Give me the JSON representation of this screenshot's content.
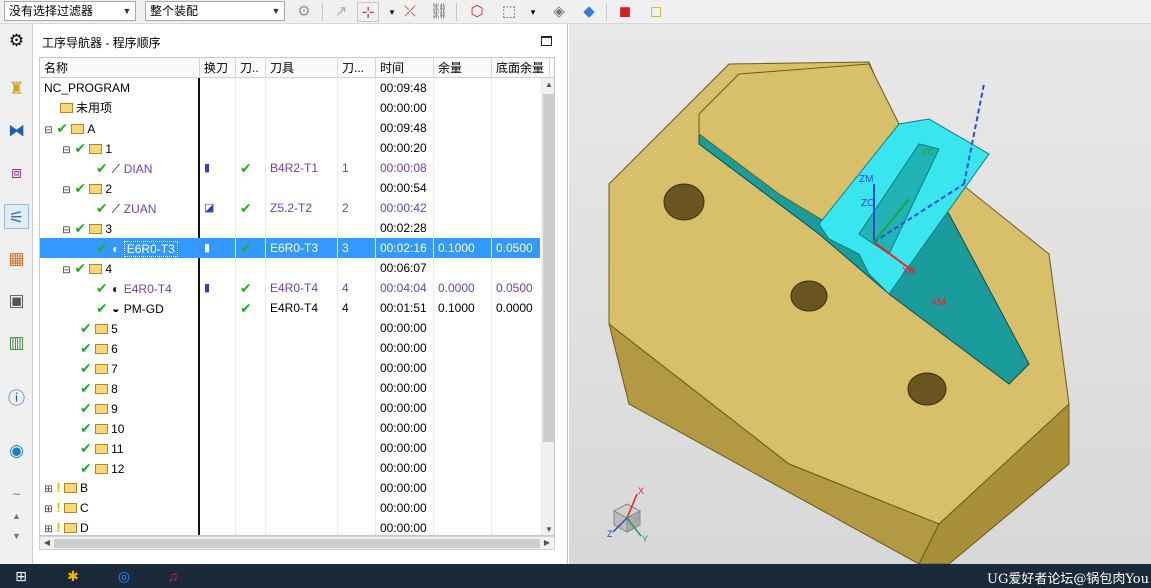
{
  "toolbar": {
    "filter_value": "没有选择过滤器",
    "scope_value": "整个装配"
  },
  "panel": {
    "title": "工序导航器 - 程序顺序"
  },
  "columns": [
    "名称",
    "换刀",
    "刀..",
    "刀具",
    "刀...",
    "时间",
    "余量",
    "底面余量"
  ],
  "rows": [
    {
      "name": "NC_PROGRAM",
      "time": "00:09:48"
    },
    {
      "name": "未用项",
      "time": "00:00:00"
    },
    {
      "name": "A",
      "time": "00:09:48"
    },
    {
      "name": "1",
      "time": "00:00:20"
    },
    {
      "name": "DIAN",
      "tool": "B4R2-T1",
      "tool_no": "1",
      "time": "00:00:08"
    },
    {
      "name": "2",
      "time": "00:00:54"
    },
    {
      "name": "ZUAN",
      "tool": "Z5.2-T2",
      "tool_no": "2",
      "time": "00:00:42"
    },
    {
      "name": "3",
      "time": "00:02:28"
    },
    {
      "name": "E6R0-T3",
      "tool": "E6R0-T3",
      "tool_no": "3",
      "time": "00:02:16",
      "stock": "0.1000",
      "floor": "0.0500"
    },
    {
      "name": "4",
      "time": "00:06:07"
    },
    {
      "name": "E4R0-T4",
      "tool": "E4R0-T4",
      "tool_no": "4",
      "time": "00:04:04",
      "stock": "0.0000",
      "floor": "0.0500"
    },
    {
      "name": "PM-GD",
      "tool": "E4R0-T4",
      "tool_no": "4",
      "time": "00:01:51",
      "stock": "0.1000",
      "floor": "0.0000"
    },
    {
      "name": "5",
      "time": "00:00:00"
    },
    {
      "name": "6",
      "time": "00:00:00"
    },
    {
      "name": "7",
      "time": "00:00:00"
    },
    {
      "name": "8",
      "time": "00:00:00"
    },
    {
      "name": "9",
      "time": "00:00:00"
    },
    {
      "name": "10",
      "time": "00:00:00"
    },
    {
      "name": "11",
      "time": "00:00:00"
    },
    {
      "name": "12",
      "time": "00:00:00"
    },
    {
      "name": "B",
      "time": "00:00:00"
    },
    {
      "name": "C",
      "time": "00:00:00"
    },
    {
      "name": "D",
      "time": "00:00:00"
    }
  ],
  "viewport": {
    "axis_labels": {
      "zm": "ZM",
      "zc": "ZC",
      "yc": "YC",
      "xc": "XC",
      "xm": "XM",
      "triad_x": "X",
      "triad_z": "Z",
      "triad_y": "Y"
    },
    "watermark": "UG爱好者论坛@锅包肉You",
    "colors": {
      "part": "#d8c06a",
      "face": "#1fb3b3",
      "highlight": "#39e6ef",
      "background": "#e0e0e0"
    }
  },
  "icons": {
    "rail": [
      "gear-icon",
      "assembly-icon",
      "constraint-icon",
      "part-nav-icon",
      "operation-nav-icon",
      "machine-icon",
      "reuse-library-icon",
      "history-icon",
      "info-icon",
      "web-browser-icon"
    ],
    "taskbar": [
      "windows-start-icon",
      "app-icon",
      "browser-icon",
      "music-icon"
    ]
  }
}
